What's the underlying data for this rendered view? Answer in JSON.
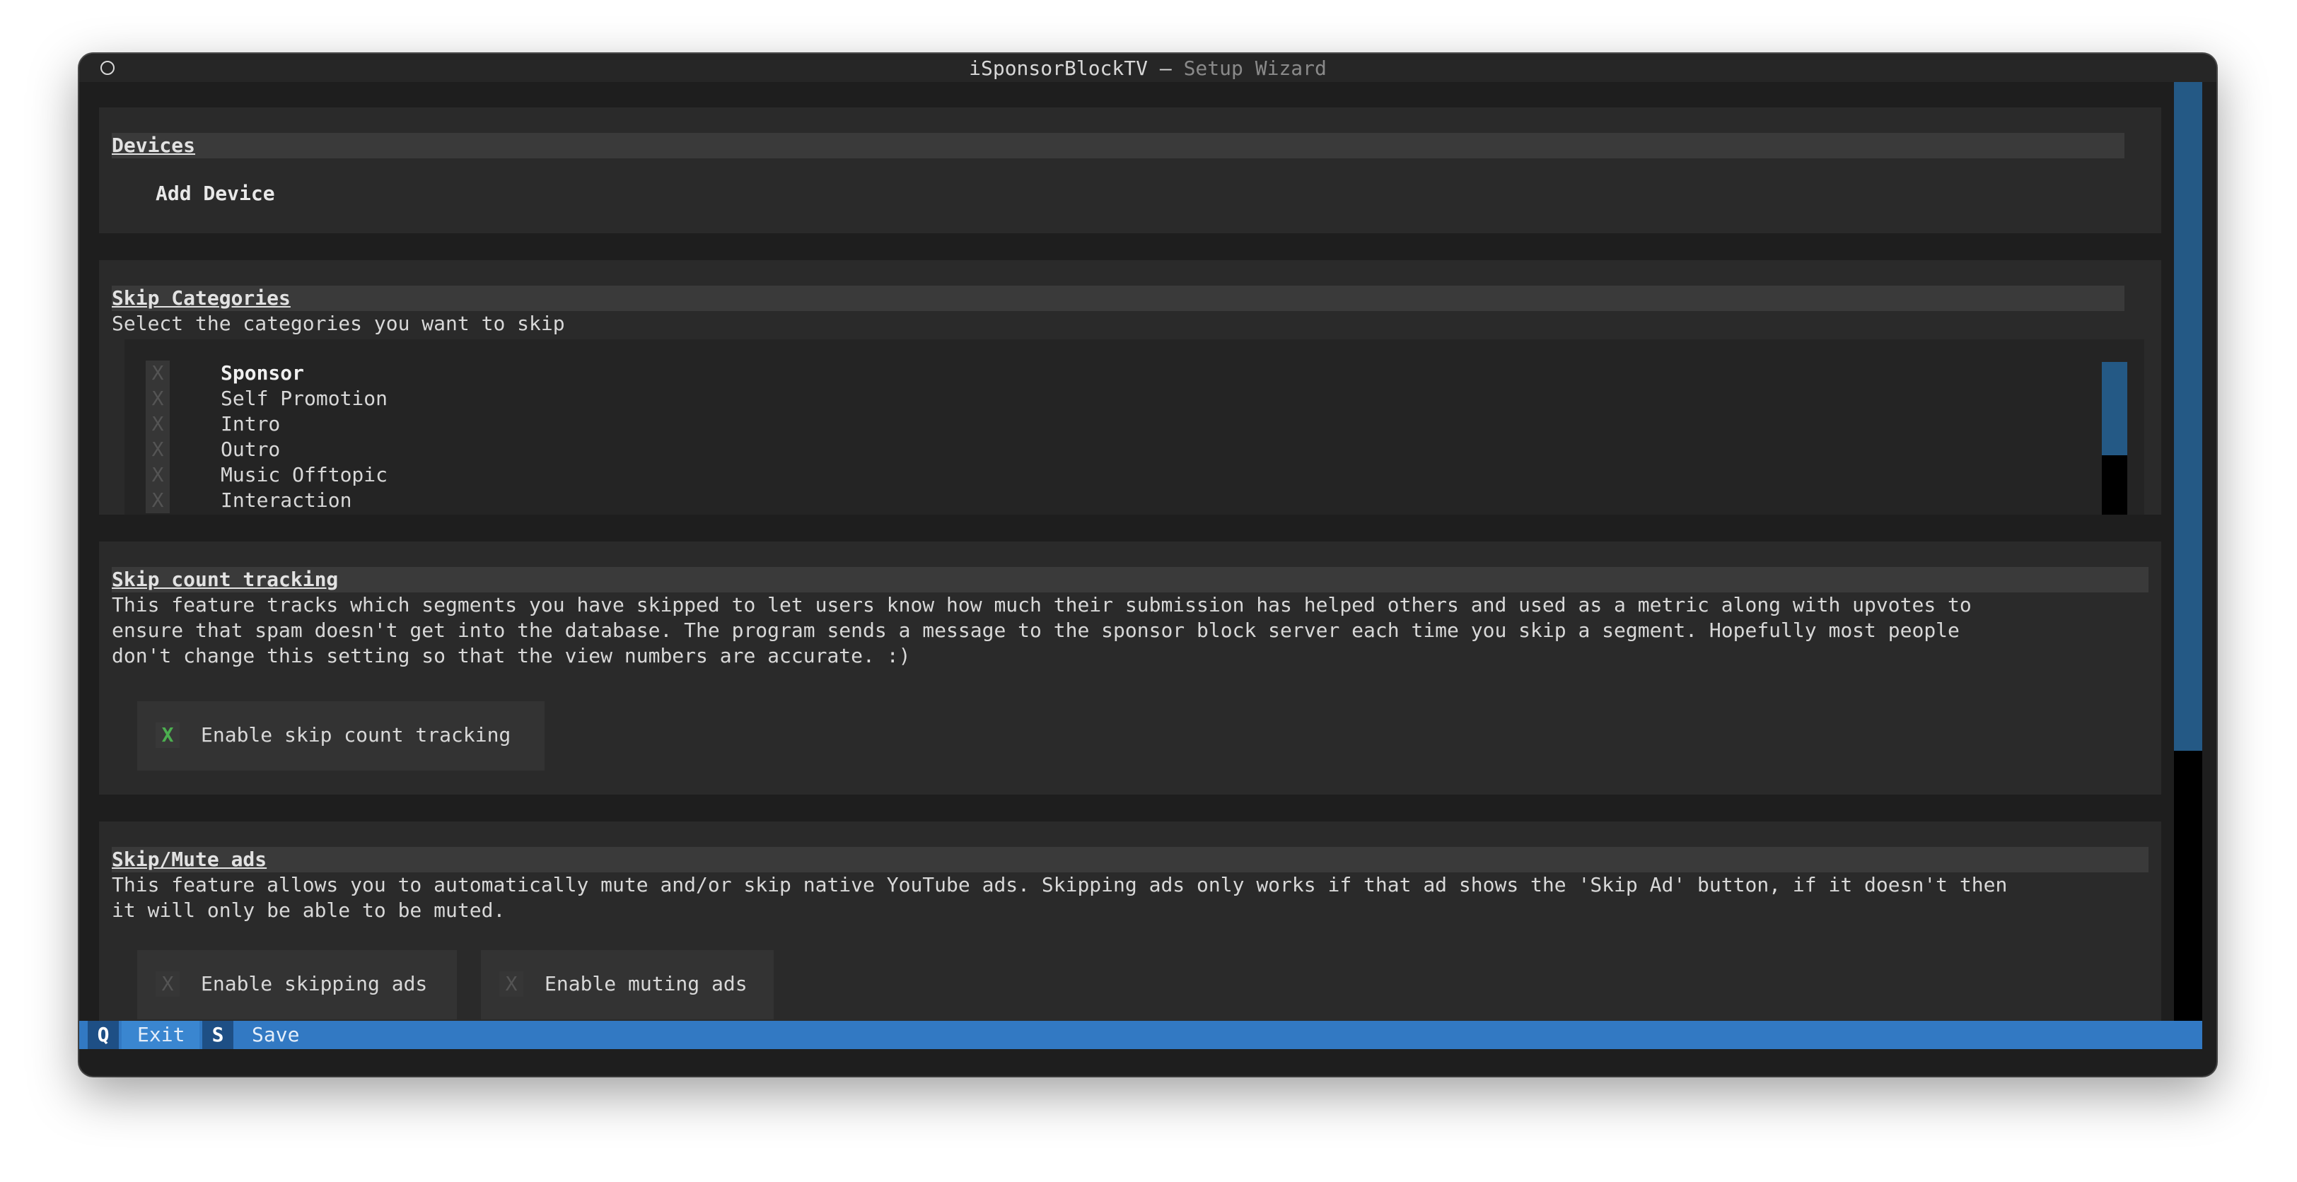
{
  "window": {
    "title_app": "iSponsorBlockTV",
    "title_separator": " — ",
    "title_sub": "Setup Wizard"
  },
  "devices": {
    "title": "Devices",
    "add_label": "Add Device"
  },
  "skip_categories": {
    "title": "Skip Categories",
    "description": "Select the categories you want to skip",
    "items": [
      {
        "mark": "X",
        "label": "Sponsor",
        "selected": true
      },
      {
        "mark": "X",
        "label": "Self Promotion",
        "selected": false
      },
      {
        "mark": "X",
        "label": "Intro",
        "selected": false
      },
      {
        "mark": "X",
        "label": "Outro",
        "selected": false
      },
      {
        "mark": "X",
        "label": "Music Offtopic",
        "selected": false
      },
      {
        "mark": "X",
        "label": "Interaction",
        "selected": false
      }
    ]
  },
  "skip_count": {
    "title": "Skip count tracking",
    "description_lines": [
      "This feature tracks which segments you have skipped to let users know how much their submission has helped others and used as a metric along with upvotes to",
      "ensure that spam doesn't get into the database. The program sends a message to the sponsor block server each time you skip a segment. Hopefully most people",
      "don't change this setting so that the view numbers are accurate. :)"
    ],
    "checkbox_mark": "X",
    "checkbox_label": "Enable skip count tracking",
    "checked": true
  },
  "skip_mute_ads": {
    "title": "Skip/Mute ads",
    "description_lines": [
      "This feature allows you to automatically mute and/or skip native YouTube ads. Skipping ads only works if that ad shows the 'Skip Ad' button, if it doesn't then",
      "it will only be able to be muted."
    ],
    "skip_mark": "X",
    "skip_label": "Enable skipping ads",
    "skip_checked": false,
    "mute_mark": "X",
    "mute_label": "Enable muting ads",
    "mute_checked": false
  },
  "footer": {
    "exit_key": "Q",
    "exit_label": "Exit",
    "save_key": "S",
    "save_label": "Save"
  },
  "colors": {
    "accent": "#3279c3",
    "scroll_thumb": "#245985",
    "checked": "#4caf50",
    "panel": "#2a2a2a",
    "background": "#1e1e1e"
  }
}
